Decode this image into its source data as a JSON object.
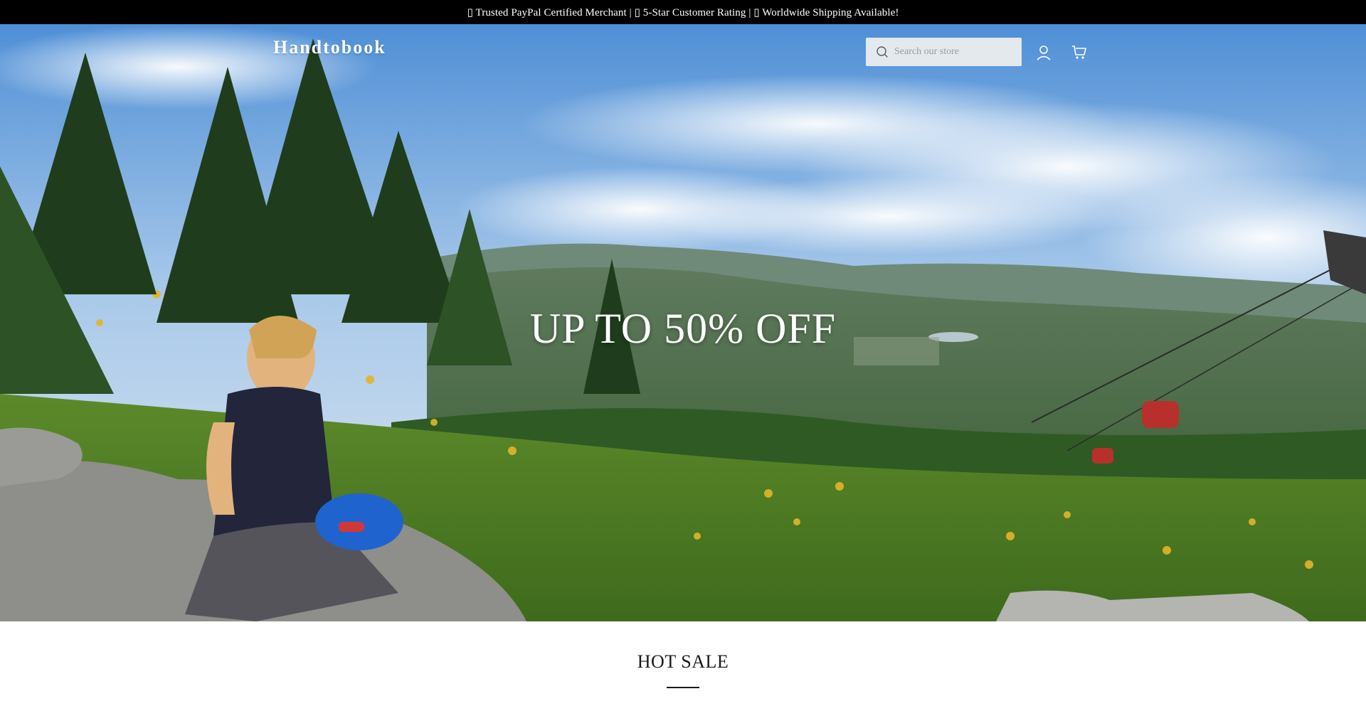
{
  "announcement": {
    "text": "▯ Trusted PayPal Certified Merchant | ▯ 5-Star Customer Rating | ▯ Worldwide Shipping Available!"
  },
  "header": {
    "logo": "Handtobook",
    "search_placeholder": "Search our store",
    "search_icon": "search-icon",
    "account_icon": "user-icon",
    "cart_icon": "cart-icon"
  },
  "hero": {
    "title": "UP TO 50% OFF",
    "image": "mountain-landscape-woman-helmet-gondola"
  },
  "sections": {
    "hot_sale_title": "HOT SALE"
  },
  "colors": {
    "announcement_bg": "#000000",
    "text_dark": "#1a1a1a",
    "white": "#ffffff"
  }
}
